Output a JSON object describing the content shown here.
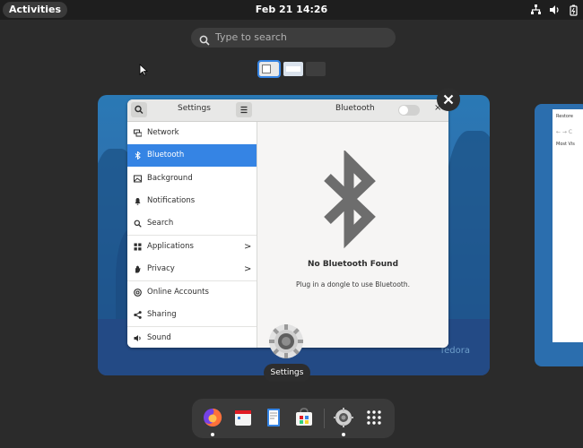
{
  "topbar": {
    "activities_label": "Activities",
    "clock": "Feb 21  14:26",
    "status_icons": [
      "network-icon",
      "volume-icon",
      "battery-icon"
    ]
  },
  "search": {
    "placeholder": "Type to search"
  },
  "workspaces": [
    "workspace-1",
    "workspace-2",
    "workspace-3"
  ],
  "settings_window": {
    "sidebar_title": "Settings",
    "panel_title": "Bluetooth",
    "sidebar_items": [
      {
        "label": "Network",
        "icon": "network-icon",
        "selected": false
      },
      {
        "label": "Bluetooth",
        "icon": "bluetooth-icon",
        "selected": true
      },
      {
        "label": "Background",
        "icon": "background-icon",
        "selected": false
      },
      {
        "label": "Notifications",
        "icon": "bell-icon",
        "selected": false
      },
      {
        "label": "Search",
        "icon": "search-icon",
        "selected": false
      },
      {
        "label": "Applications",
        "icon": "grid-icon",
        "selected": false,
        "chevron": ">"
      },
      {
        "label": "Privacy",
        "icon": "hand-icon",
        "selected": false,
        "chevron": ">"
      },
      {
        "label": "Online Accounts",
        "icon": "at-icon",
        "selected": false
      },
      {
        "label": "Sharing",
        "icon": "share-icon",
        "selected": false
      },
      {
        "label": "Sound",
        "icon": "sound-icon",
        "selected": false
      }
    ],
    "empty_state": {
      "title": "No Bluetooth Found",
      "subtitle": "Plug in a dongle to use Bluetooth."
    },
    "close_glyph": "×",
    "bluetooth_toggle_on": false
  },
  "overview_close_glyph": "✕",
  "window_app_label": "Settings",
  "background_watermark": "fedora",
  "side_window": {
    "title": "Restore",
    "nav": "←  →  C",
    "tab": "Most Vis"
  },
  "dock": {
    "apps": [
      "firefox-icon",
      "calendar-icon",
      "text-editor-icon",
      "software-icon",
      "settings-icon",
      "show-apps-icon"
    ]
  },
  "colors": {
    "accent": "#3584e4",
    "panel": "#1e1e1e",
    "overview_bg": "#2b2b2b"
  }
}
